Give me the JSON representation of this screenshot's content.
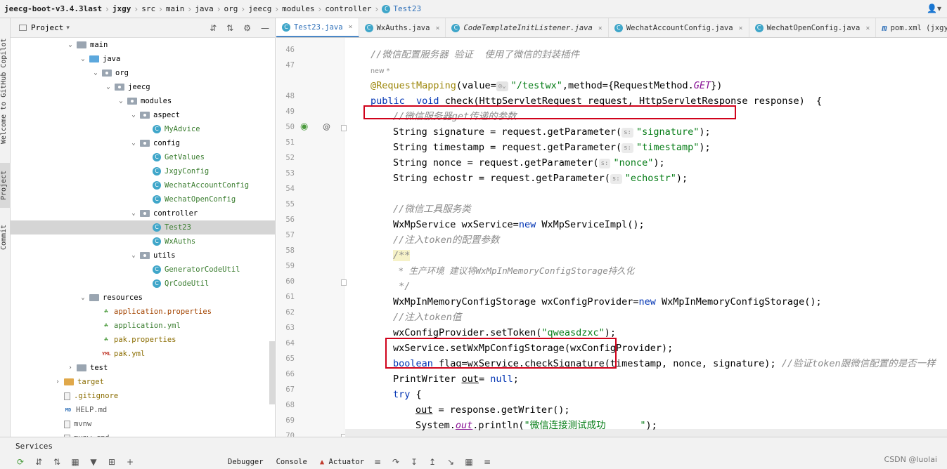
{
  "breadcrumb": [
    "jeecg-boot-v3.4.3last",
    "jxgy",
    "src",
    "main",
    "java",
    "org",
    "jeecg",
    "modules",
    "controller",
    "Test23"
  ],
  "left_strip": {
    "copilot": "Welcome to GitHub Copilot",
    "project": "Project",
    "commit": "Commit"
  },
  "project_panel": {
    "title": "Project",
    "tree": [
      {
        "label": "main",
        "indent": 0,
        "arrow": "v",
        "icon": "folder-grey"
      },
      {
        "label": "java",
        "indent": 1,
        "arrow": "v",
        "icon": "folder-blue"
      },
      {
        "label": "org",
        "indent": 2,
        "arrow": "v",
        "icon": "package"
      },
      {
        "label": "jeecg",
        "indent": 3,
        "arrow": "v",
        "icon": "package"
      },
      {
        "label": "modules",
        "indent": 4,
        "arrow": "v",
        "icon": "package"
      },
      {
        "label": "aspect",
        "indent": 5,
        "arrow": "v",
        "icon": "package"
      },
      {
        "label": "MyAdvice",
        "indent": 6,
        "arrow": "",
        "icon": "class"
      },
      {
        "label": "config",
        "indent": 5,
        "arrow": "v",
        "icon": "package"
      },
      {
        "label": "GetValues",
        "indent": 6,
        "arrow": "",
        "icon": "class"
      },
      {
        "label": "JxgyConfig",
        "indent": 6,
        "arrow": "",
        "icon": "class"
      },
      {
        "label": "WechatAccountConfig",
        "indent": 6,
        "arrow": "",
        "icon": "class"
      },
      {
        "label": "WechatOpenConfig",
        "indent": 6,
        "arrow": "",
        "icon": "class"
      },
      {
        "label": "controller",
        "indent": 5,
        "arrow": "v",
        "icon": "package"
      },
      {
        "label": "Test23",
        "indent": 6,
        "arrow": "",
        "icon": "class",
        "selected": true
      },
      {
        "label": "WxAuths",
        "indent": 6,
        "arrow": "",
        "icon": "class"
      },
      {
        "label": "utils",
        "indent": 5,
        "arrow": "v",
        "icon": "package"
      },
      {
        "label": "GeneratorCodeUtil",
        "indent": 6,
        "arrow": "",
        "icon": "class"
      },
      {
        "label": "QrCodeUtil",
        "indent": 6,
        "arrow": "",
        "icon": "class"
      },
      {
        "label": "resources",
        "indent": 1,
        "arrow": "v",
        "icon": "folder-grey"
      },
      {
        "label": "application.properties",
        "indent": 2,
        "arrow": "",
        "icon": "props",
        "color": "red"
      },
      {
        "label": "application.yml",
        "indent": 2,
        "arrow": "",
        "icon": "props",
        "color": "green"
      },
      {
        "label": "pak.properties",
        "indent": 2,
        "arrow": "",
        "icon": "props",
        "color": "orange"
      },
      {
        "label": "pak.yml",
        "indent": 2,
        "arrow": "",
        "icon": "yml",
        "color": "orange"
      },
      {
        "label": "test",
        "indent": 0,
        "arrow": ">",
        "icon": "folder-grey"
      },
      {
        "label": "target",
        "indent": -1,
        "arrow": ">",
        "icon": "folder-orange",
        "color": "orange"
      },
      {
        "label": ".gitignore",
        "indent": -1,
        "arrow": "",
        "icon": "file",
        "color": "orange"
      },
      {
        "label": "HELP.md",
        "indent": -1,
        "arrow": "",
        "icon": "md",
        "color": "grey"
      },
      {
        "label": "mvnw",
        "indent": -1,
        "arrow": "",
        "icon": "file",
        "color": "grey"
      },
      {
        "label": "mvnw.cmd",
        "indent": -1,
        "arrow": "",
        "icon": "file",
        "color": "grey"
      }
    ]
  },
  "editor_tabs": [
    {
      "label": "Test23.java",
      "active": true,
      "icon": "class"
    },
    {
      "label": "WxAuths.java",
      "icon": "class"
    },
    {
      "label": "CodeTemplateInitListener.java",
      "icon": "class",
      "italic": true
    },
    {
      "label": "WechatAccountConfig.java",
      "icon": "class"
    },
    {
      "label": "WechatOpenConfig.java",
      "icon": "class"
    },
    {
      "label": "pom.xml (jxgy)",
      "icon": "maven"
    }
  ],
  "code": {
    "usage_hint": "new *",
    "line_numbers": [
      "46",
      "47",
      "48",
      "49",
      "50",
      "51",
      "52",
      "53",
      "54",
      "55",
      "56",
      "57",
      "58",
      "59",
      "60",
      "61",
      "62",
      "63",
      "64",
      "65",
      "66",
      "67",
      "68",
      "69",
      "70"
    ],
    "lines": {
      "47": "//微信配置服务器 验证  使用了微信的封装插件",
      "48_a": "@RequestMapping",
      "48_b": "(value=",
      "48_c": "\"/testwx\"",
      "48_d": ",method={RequestMethod.",
      "48_e": "GET",
      "48_f": "})",
      "49_a": "public",
      "49_b": "  void ",
      "49_c": "check(HttpServletRequest request, HttpServletResponse response)  {",
      "50": "//微信服务器get传递的参数",
      "51_a": "String signature = request.getParameter(",
      "51_b": "\"signature\"",
      "51_c": ");",
      "52_a": "String timestamp = request.getParameter(",
      "52_b": "\"timestamp\"",
      "52_c": ");",
      "53_a": "String nonce = request.getParameter(",
      "53_b": "\"nonce\"",
      "53_c": ");",
      "54_a": "String echostr = request.getParameter(",
      "54_b": "\"echostr\"",
      "54_c": ");",
      "56": "//微信工具服务类",
      "57_a": "WxMpService wxService=",
      "57_b": "new",
      "57_c": " WxMpServiceImpl();",
      "58": "//注入token的配置参数",
      "59": "/**",
      "60": " * 生产环境 建议将WxMpInMemoryConfigStorage持久化",
      "61": " */",
      "62_a": "WxMpInMemoryConfigStorage wxConfigProvider=",
      "62_b": "new",
      "62_c": " WxMpInMemoryConfigStorage();",
      "63": "//注入token值",
      "64_a": "wxConfigProvider.setToken(",
      "64_b": "\"qweasdzxc\"",
      "64_c": ");",
      "65": "wxService.setWxMpConfigStorage(wxConfigProvider);",
      "66_a": "boolean",
      "66_b": " flag=wxService.checkSignature(timestamp, nonce, signature); ",
      "66_c": "//验证token跟微信配置的是否一样",
      "67_a": "PrintWriter ",
      "67_b": "out",
      "67_c": "= ",
      "67_d": "null",
      "67_e": ";",
      "68_a": "try",
      "68_b": " {",
      "69_a": "out",
      "69_b": " = response.getWriter();",
      "70_a": "System.",
      "70_b": "out",
      "70_c": ".println(",
      "70_d": "\"微信连接测试成功      \"",
      "70_e": ");"
    },
    "param_hint": "s:"
  },
  "services": {
    "label": "Services"
  },
  "bottom_tabs": [
    "Debugger",
    "Console",
    "Actuator"
  ],
  "watermark": "CSDN @luolai",
  "colors": {
    "highlight_box": "#d0021b",
    "keyword": "#0033b3",
    "string": "#067d17",
    "comment": "#8c8c8c",
    "annotation": "#9e880d"
  }
}
